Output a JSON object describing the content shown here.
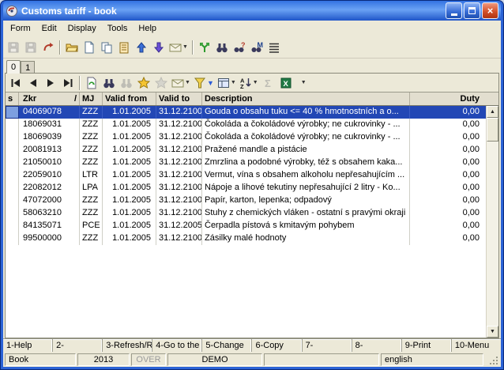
{
  "window": {
    "title": "Customs tariff - book"
  },
  "menu": {
    "items": [
      {
        "label": "Form"
      },
      {
        "label": "Edit"
      },
      {
        "label": "Display"
      },
      {
        "label": "Tools"
      },
      {
        "label": "Help"
      }
    ]
  },
  "toolbar_main": {
    "icons": [
      "save",
      "save-as",
      "undo",
      "open-folder",
      "new-document",
      "copy",
      "paste",
      "move-up",
      "move-down",
      "send-mail",
      "export",
      "find",
      "find-next",
      "find-advanced",
      "list"
    ]
  },
  "toolbar_record": {
    "icons": [
      "first-record",
      "previous-record",
      "next-record",
      "last-record",
      "refresh",
      "find",
      "find-all",
      "bookmark-star",
      "mail",
      "filter",
      "form-view",
      "sort",
      "summary",
      "excel-export",
      "more"
    ]
  },
  "tabs": {
    "items": [
      {
        "label": "0"
      },
      {
        "label": "1"
      }
    ]
  },
  "grid": {
    "columns": {
      "s": "s",
      "zkr": "Zkr",
      "sort_indicator": "/",
      "mj": "MJ",
      "from": "Valid from",
      "to": "Valid to",
      "desc": "Description",
      "duty": "Duty"
    },
    "rows": [
      {
        "zkr": "04069078",
        "mj": "ZZZ",
        "from": "1.01.2005",
        "to": "31.12.2100",
        "desc": "Gouda o obsahu tuku <= 40 % hmotnostních a o...",
        "duty": "0,00",
        "selected": true
      },
      {
        "zkr": "18069031",
        "mj": "ZZZ",
        "from": "1.01.2005",
        "to": "31.12.2100",
        "desc": "Čokoláda a čokoládové výrobky; ne cukrovinky - ...",
        "duty": "0,00"
      },
      {
        "zkr": "18069039",
        "mj": "ZZZ",
        "from": "1.01.2005",
        "to": "31.12.2100",
        "desc": "Čokoláda a čokoládové výrobky; ne cukrovinky - ...",
        "duty": "0,00"
      },
      {
        "zkr": "20081913",
        "mj": "ZZZ",
        "from": "1.01.2005",
        "to": "31.12.2100",
        "desc": "Pražené mandle a pistácie",
        "duty": "0,00"
      },
      {
        "zkr": "21050010",
        "mj": "ZZZ",
        "from": "1.01.2005",
        "to": "31.12.2100",
        "desc": "Zmrzlina a podobné výrobky, též s obsahem kaka...",
        "duty": "0,00"
      },
      {
        "zkr": "22059010",
        "mj": "LTR",
        "from": "1.01.2005",
        "to": "31.12.2100",
        "desc": "Vermut, vína s obsahem alkoholu nepřesahujícím ...",
        "duty": "0,00"
      },
      {
        "zkr": "22082012",
        "mj": "LPA",
        "from": "1.01.2005",
        "to": "31.12.2100",
        "desc": "Nápoje a lihové tekutiny nepřesahující 2 litry - Ko...",
        "duty": "0,00"
      },
      {
        "zkr": "47072000",
        "mj": "ZZZ",
        "from": "1.01.2005",
        "to": "31.12.2100",
        "desc": "Papír, karton, lepenka; odpadový",
        "duty": "0,00"
      },
      {
        "zkr": "58063210",
        "mj": "ZZZ",
        "from": "1.01.2005",
        "to": "31.12.2100",
        "desc": "Stuhy z chemických vláken - ostatní s pravými okraji",
        "duty": "0,00"
      },
      {
        "zkr": "84135071",
        "mj": "PCE",
        "from": "1.01.2005",
        "to": "31.12.2005",
        "desc": "Čerpadla pístová s kmitavým pohybem",
        "duty": "0,00"
      },
      {
        "zkr": "99500000",
        "mj": "ZZZ",
        "from": "1.01.2005",
        "to": "31.12.2100",
        "desc": "Zásilky malé hodnoty",
        "duty": "0,00"
      }
    ]
  },
  "fkeys": [
    "1-Help",
    "2-",
    "3-Refresh/R",
    "4-Go to the",
    "5-Change",
    "6-Copy",
    "7-",
    "8-",
    "9-Print",
    "10-Menu"
  ],
  "status": {
    "book": "Book",
    "year": "2013",
    "over": "OVER",
    "demo": "DEMO",
    "lang": "english"
  }
}
